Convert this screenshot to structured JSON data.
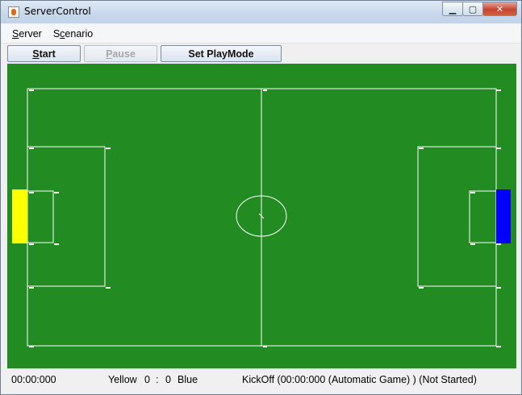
{
  "window": {
    "title": "ServerControl",
    "caption_buttons": {
      "minimize": "▁",
      "maximize": "▢",
      "close": "✕"
    }
  },
  "menu": {
    "server": {
      "mnemonic": "S",
      "rest": "erver"
    },
    "scenario": {
      "pre": "S",
      "mnemonic": "c",
      "rest": "enario"
    }
  },
  "toolbar": {
    "start": {
      "mnemonic": "S",
      "rest": "tart"
    },
    "pause": {
      "mnemonic": "P",
      "rest": "ause",
      "enabled": false
    },
    "playmode": "Set PlayMode"
  },
  "field": {
    "colors": {
      "grass": "#228b22",
      "lines": "#ffffff",
      "yellow_goal": "#ffff00",
      "blue_goal": "#0000ff"
    }
  },
  "status": {
    "time": "00:00:000",
    "yellow_label": "Yellow",
    "yellow_score": "0",
    "separator": ":",
    "blue_score": "0",
    "blue_label": "Blue",
    "playmode": "KickOff (00:00:000 (Automatic Game) ) (Not Started)"
  }
}
